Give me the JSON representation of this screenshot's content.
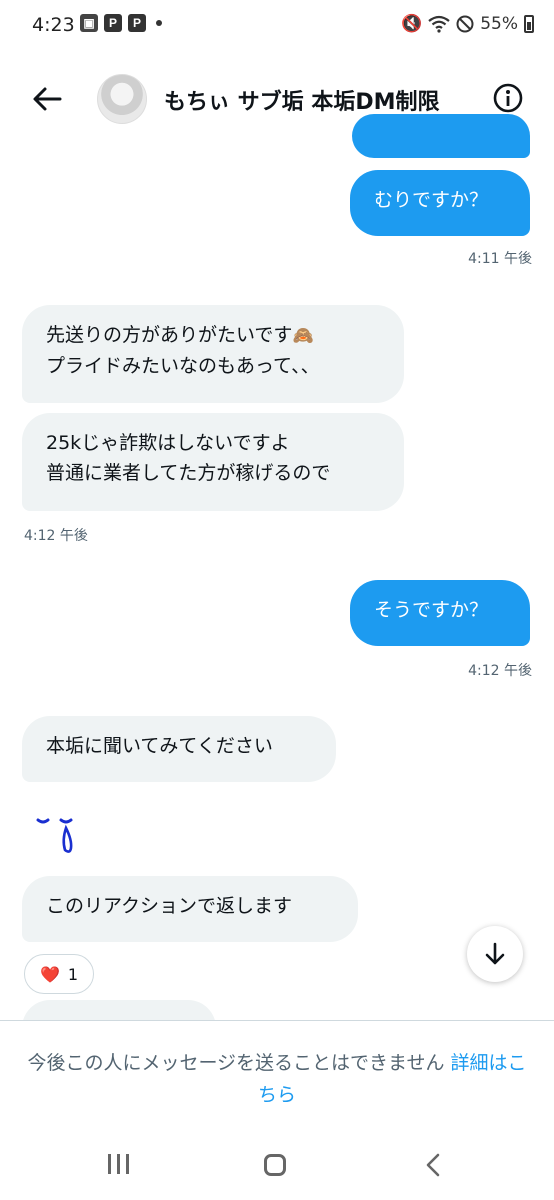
{
  "status_bar": {
    "time": "4:23",
    "battery": "55%",
    "app_icons": [
      "P",
      "P"
    ]
  },
  "header": {
    "title": "もちぃ サブ垢 本垢DM制限"
  },
  "messages": [
    {
      "text": "むりですか？"
    },
    {
      "timestamp": "4:11 午後"
    },
    {
      "line1": "先送りの方がありがたいです",
      "emoji": "🙈",
      "line2": "プライドみたいなのもあって、、"
    },
    {
      "line1": "25kじゃ詐欺はしないですよ",
      "line2": "普通に業者してた方が稼げるので"
    },
    {
      "timestamp": "4:12 午後"
    },
    {
      "text": "そうですか？"
    },
    {
      "timestamp": "4:12 午後"
    },
    {
      "text": "本垢に聞いてみてください"
    },
    {
      "sticker": "ˇ̥ˇ"
    },
    {
      "text": "このリアクションで返します"
    }
  ],
  "reaction": {
    "emoji": "❤️",
    "count": "1"
  },
  "footer": {
    "notice": "今後この人にメッセージを送ることはできません",
    "link": "詳細はこちら"
  },
  "colors": {
    "accent": "#1d9bf0",
    "bubble_in": "#eff3f4",
    "muted": "#536471"
  }
}
